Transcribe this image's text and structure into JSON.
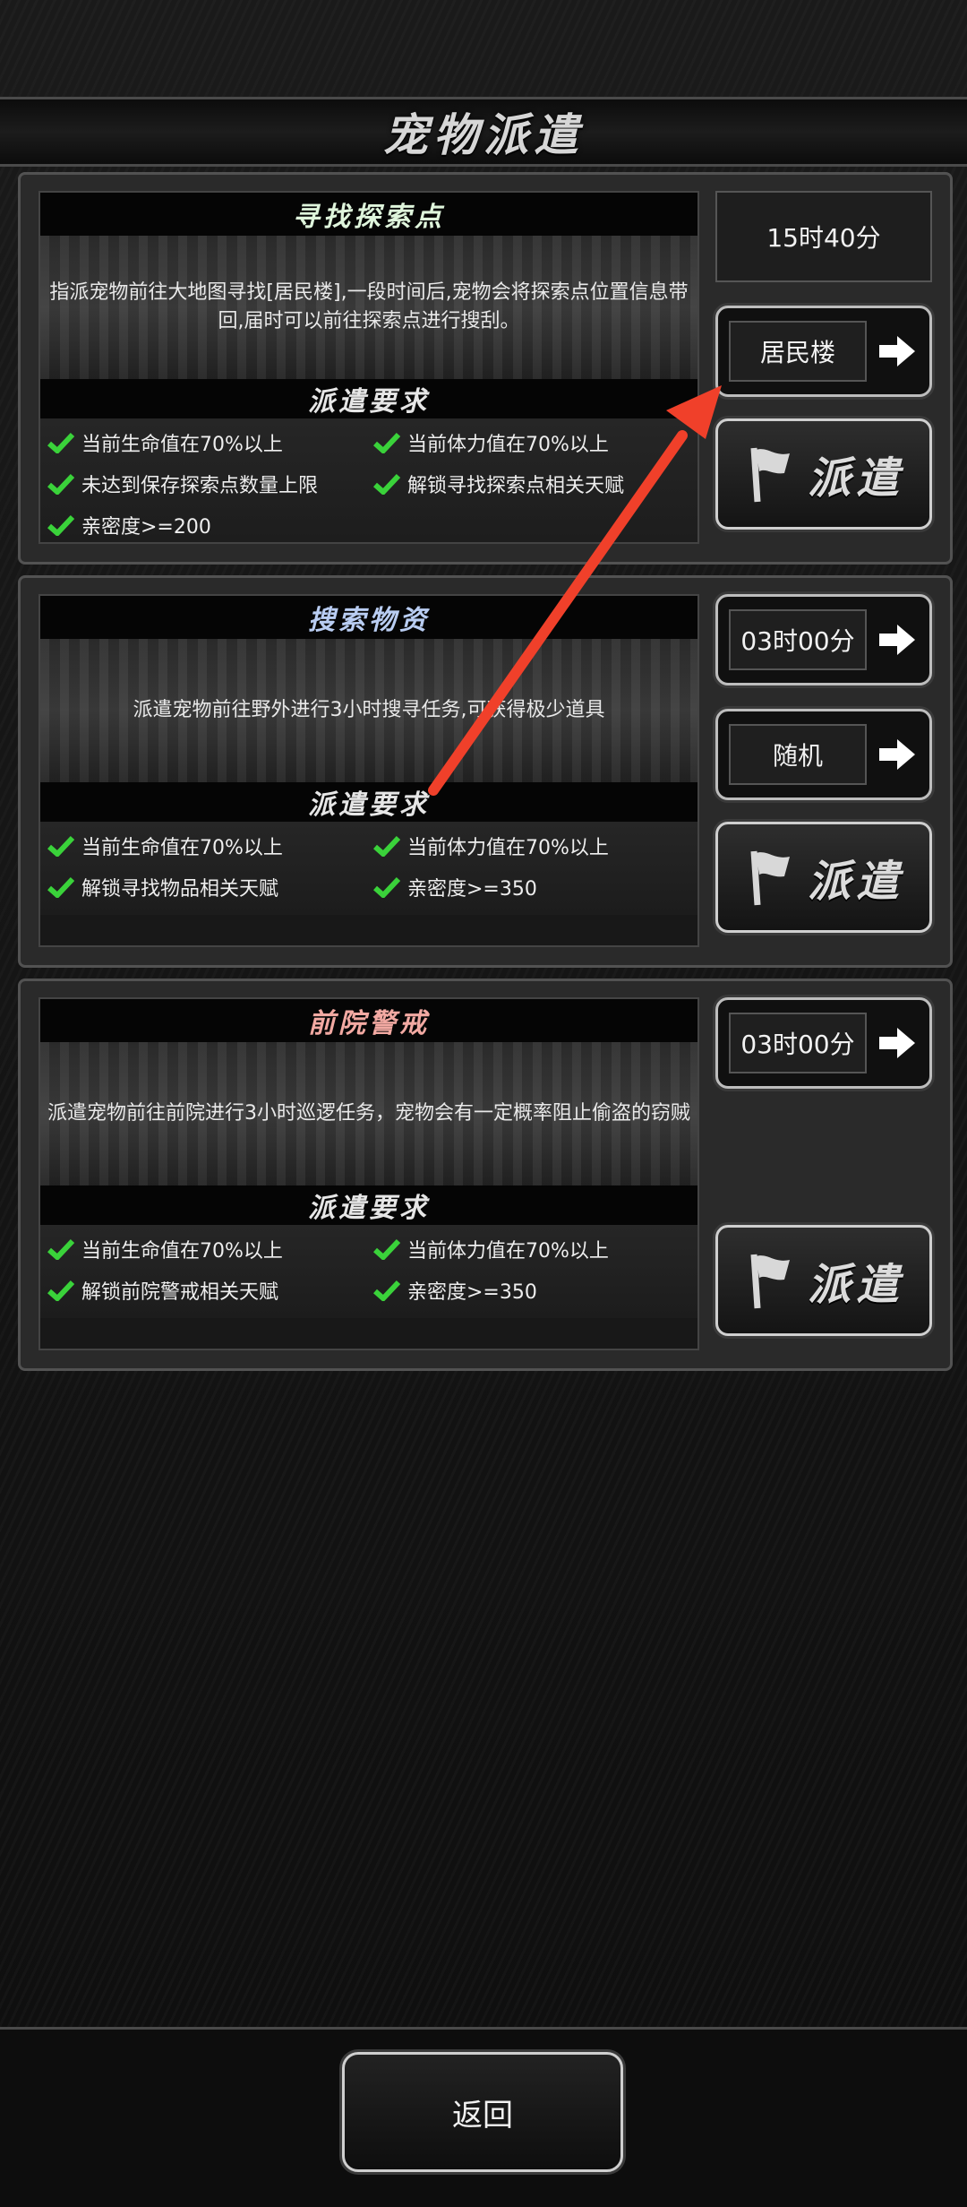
{
  "page": {
    "title": "宠物派遣",
    "back_label": "返回"
  },
  "colors": {
    "check": "#3ad23a",
    "mission_1_title": "#dff5dc",
    "mission_2_title": "#b9cdf2",
    "mission_3_title": "#f2a9a2",
    "annotation_arrow": "#f0402a"
  },
  "missions": [
    {
      "title": "寻找探索点",
      "description": "指派宠物前往大地图寻找[居民楼],一段时间后,宠物会将探索点位置信息带回,届时可以前往探索点进行搜刮。",
      "requirements_title": "派遣要求",
      "requirements": [
        "当前生命值在70%以上",
        "当前体力值在70%以上",
        "未达到保存探索点数量上限",
        "解锁寻找探索点相关天赋",
        "亲密度>=200"
      ],
      "timer": "15时40分",
      "selector": "居民楼",
      "dispatch_label": "派遣"
    },
    {
      "title": "搜索物资",
      "description": "派遣宠物前往野外进行3小时搜寻任务,可获得极少道具",
      "requirements_title": "派遣要求",
      "requirements": [
        "当前生命值在70%以上",
        "当前体力值在70%以上",
        "解锁寻找物品相关天赋",
        "亲密度>=350"
      ],
      "duration": "03时00分",
      "selector": "随机",
      "dispatch_label": "派遣"
    },
    {
      "title": "前院警戒",
      "description": "派遣宠物前往前院进行3小时巡逻任务，宠物会有一定概率阻止偷盗的窃贼",
      "requirements_title": "派遣要求",
      "requirements": [
        "当前生命值在70%以上",
        "当前体力值在70%以上",
        "解锁前院警戒相关天赋",
        "亲密度>=350"
      ],
      "duration": "03时00分",
      "dispatch_label": "派遣"
    }
  ],
  "icons": {
    "check": "check-icon",
    "arrow": "arrow-right-icon",
    "flag": "flag-icon"
  }
}
